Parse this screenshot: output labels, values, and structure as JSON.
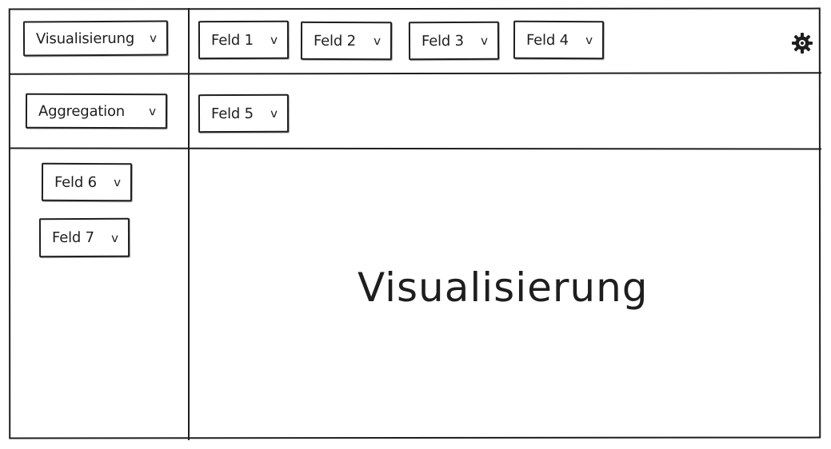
{
  "top_bar": {
    "visualization_dropdown": {
      "label": "Visualisierung",
      "chevron": "v"
    },
    "fields": [
      {
        "label": "Feld 1",
        "chevron": "v"
      },
      {
        "label": "Feld 2",
        "chevron": "v"
      },
      {
        "label": "Feld 3",
        "chevron": "v"
      },
      {
        "label": "Feld 4",
        "chevron": "v"
      }
    ],
    "settings_icon": "gear-icon"
  },
  "second_bar": {
    "aggregation_dropdown": {
      "label": "Aggregation",
      "chevron": "v"
    },
    "fields": [
      {
        "label": "Feld 5",
        "chevron": "v"
      }
    ]
  },
  "sidebar": {
    "fields": [
      {
        "label": "Feld 6",
        "chevron": "v"
      },
      {
        "label": "Feld 7",
        "chevron": "v"
      }
    ]
  },
  "main": {
    "title": "Visualisierung"
  },
  "colors": {
    "stroke": "#1e1e1e",
    "background": "#ffffff"
  }
}
